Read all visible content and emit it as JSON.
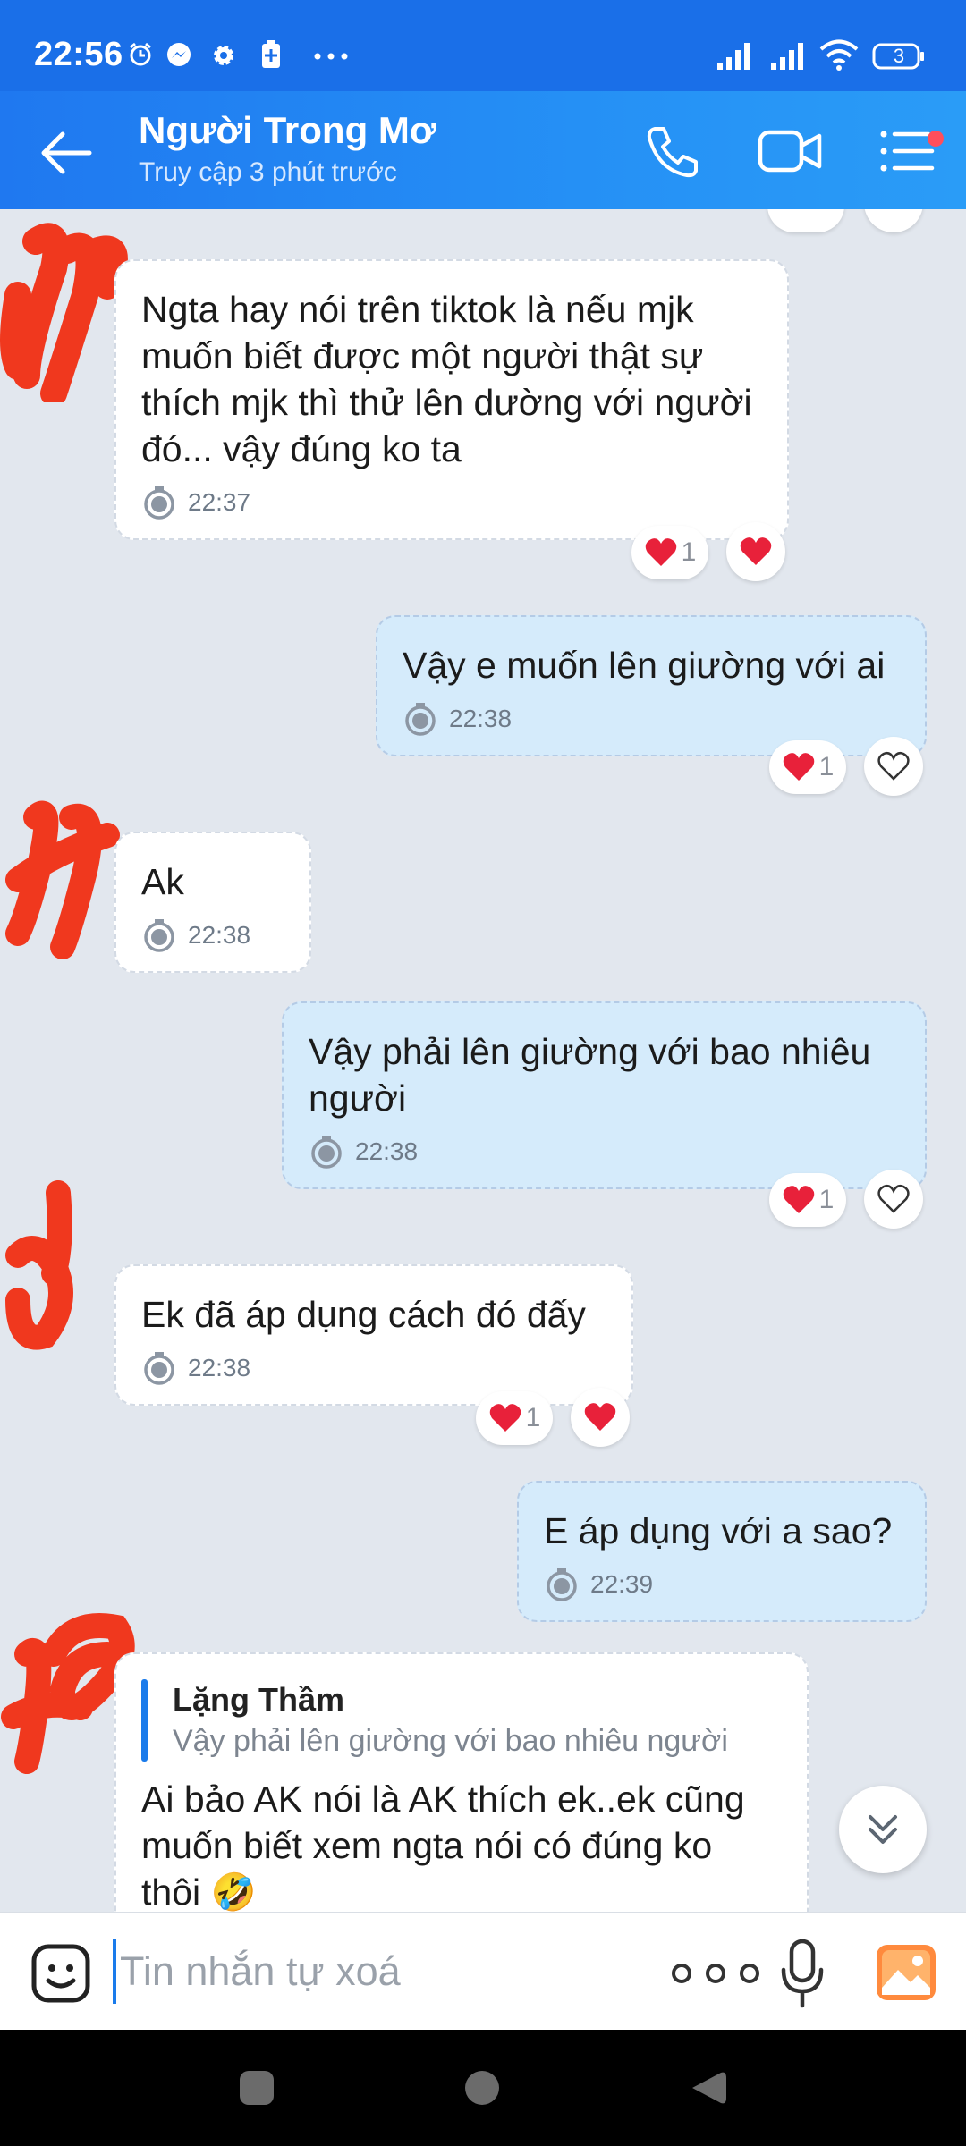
{
  "status_bar": {
    "time": "22:56",
    "battery": "3",
    "icons": [
      "alarm-icon",
      "messenger-icon",
      "gear-icon",
      "battery-saver-icon",
      "more-dots-icon",
      "signal-icon",
      "signal-icon",
      "wifi-icon",
      "battery-icon"
    ]
  },
  "header": {
    "name": "Người Trong Mơ",
    "status": "Truy cập 3 phút trước",
    "icons": [
      "back-arrow-icon",
      "phone-icon",
      "video-camera-icon",
      "menu-list-icon"
    ],
    "notification_dot_color": "#FF4E5B"
  },
  "messages": [
    {
      "direction": "in",
      "text": "Ngta hay nói trên tiktok là nếu mjk\nmuốn biết được một người thật sự\nthích mjk thì thử lên dường với người\nđó... vậy đúng ko ta",
      "time": "22:37",
      "reaction_count": "1",
      "react_button": "filled-heart"
    },
    {
      "direction": "out",
      "text": "Vậy e muốn lên giường với ai",
      "time": "22:38",
      "reaction_count": "1",
      "react_button": "outline-heart"
    },
    {
      "direction": "in",
      "text": "Ak",
      "time": "22:38"
    },
    {
      "direction": "out",
      "text": "Vậy phải lên giường với bao nhiêu\nngười",
      "time": "22:38",
      "reaction_count": "1",
      "react_button": "outline-heart"
    },
    {
      "direction": "in",
      "text": "Ek đã áp dụng cách đó đấy",
      "time": "22:38",
      "reaction_count": "1",
      "react_button": "filled-heart"
    },
    {
      "direction": "out",
      "text": "E áp dụng với a sao?",
      "time": "22:39"
    },
    {
      "direction": "in",
      "quote_author": "Lặng Thầm",
      "quote_text": "Vậy phải lên giường với bao nhiêu người",
      "text": "Ai bảo AK nói là AK thích ek..ek cũng\nmuốn biết xem ngta nói có đúng ko\nthôi 🤣"
    }
  ],
  "composer": {
    "placeholder": "Tin nhắn tự xoá",
    "icons": [
      "sticker-icon",
      "more-dots-icon",
      "microphone-icon",
      "gallery-icon"
    ]
  },
  "colors": {
    "header_blue": "#1F78F0",
    "chat_background": "#E2E7EE",
    "incoming_bubble": "#FFFFFF",
    "outgoing_bubble": "#D5EBFB",
    "heart_red": "#E8213A"
  }
}
